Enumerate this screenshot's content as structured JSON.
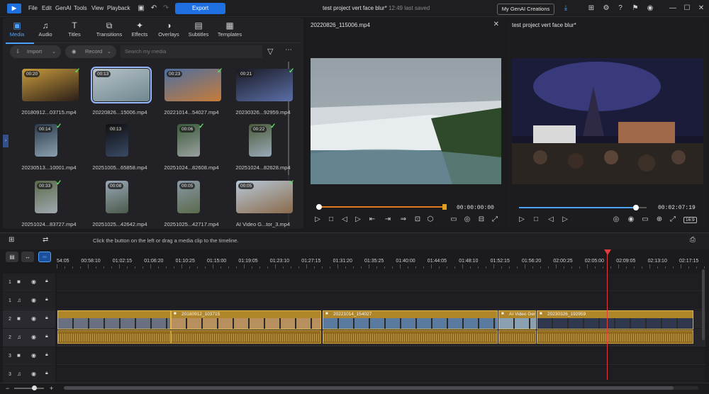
{
  "menu": {
    "file": "File",
    "edit": "Edit",
    "genai": "GenAI",
    "tools": "Tools",
    "view": "View",
    "playback": "Playback"
  },
  "export_label": "Export",
  "project": {
    "name": "test project vert face blur*",
    "saved": "12:49 last saved"
  },
  "genai_creations": "My GenAI Creations",
  "tabs": [
    {
      "label": "Media",
      "icon": "media-icon"
    },
    {
      "label": "Audio",
      "icon": "music-note-icon"
    },
    {
      "label": "Titles",
      "icon": "text-icon"
    },
    {
      "label": "Transitions",
      "icon": "transitions-icon"
    },
    {
      "label": "Effects",
      "icon": "effects-icon"
    },
    {
      "label": "Overlays",
      "icon": "overlays-icon"
    },
    {
      "label": "Subtitles",
      "icon": "subtitles-icon"
    },
    {
      "label": "Templates",
      "icon": "templates-icon"
    }
  ],
  "toolbar": {
    "import": "Import",
    "record": "Record",
    "search_placeholder": "Search my media"
  },
  "media": [
    {
      "dur": "00:20",
      "name": "20180912...03715.mp4"
    },
    {
      "dur": "00:13",
      "name": "20220826...15006.mp4"
    },
    {
      "dur": "00:23",
      "name": "20221014...54027.mp4"
    },
    {
      "dur": "00:21",
      "name": "20230326...92959.mp4"
    },
    {
      "dur": "00:14",
      "name": "20230513...10001.mp4"
    },
    {
      "dur": "00:13",
      "name": "20251005...65858.mp4"
    },
    {
      "dur": "00:06",
      "name": "20251024...82608.mp4"
    },
    {
      "dur": "00:22",
      "name": "20251024...82628.mp4"
    },
    {
      "dur": "00:33",
      "name": "20251024...83727.mp4"
    },
    {
      "dur": "00:08",
      "name": "20251025...42642.mp4"
    },
    {
      "dur": "00:05",
      "name": "20251025...42717.mp4"
    },
    {
      "dur": "00:05",
      "name": "AI Video G...tor_3.mp4"
    }
  ],
  "preview1": {
    "title": "20220826_115006.mp4",
    "timecode": "00:00:00:00"
  },
  "preview2": {
    "title": "test project vert face blur*",
    "timecode": "00:02:07:19",
    "ratio": "16:9"
  },
  "timeline": {
    "hint": "Click the button on the left or drag a media clip to the timeline.",
    "ruler": [
      "54:05",
      "00:58:10",
      "01:02:15",
      "01:06:20",
      "01:10:25",
      "01:15:00",
      "01:19:05",
      "01:23:10",
      "01:27:15",
      "01:31:20",
      "01:35:25",
      "01:40:00",
      "01:44:05",
      "01:48:10",
      "01:52:15",
      "01:56:20",
      "02:00:25",
      "02:05:00",
      "02:09:05",
      "02:13:10",
      "02:17:15"
    ],
    "tracks": [
      "1",
      "1",
      "2",
      "2",
      "3",
      "3"
    ],
    "clips": [
      "20180912_103715",
      "20221014_154027",
      "AI Video Gen",
      "20230326_192959"
    ]
  }
}
